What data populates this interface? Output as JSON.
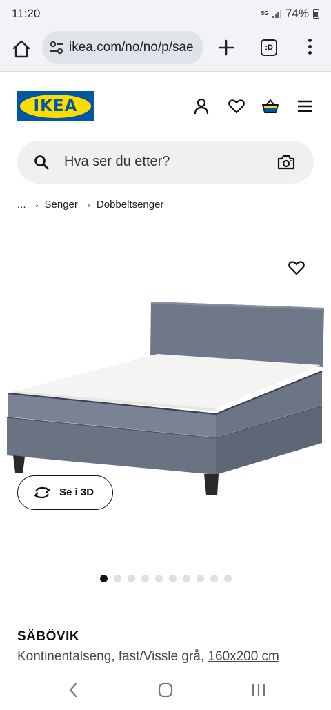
{
  "status_bar": {
    "time": "11:20",
    "network": "5G",
    "battery": "74%"
  },
  "browser": {
    "url": "ikea.com/no/no/p/sae",
    "tabs_label": ":D"
  },
  "header": {
    "logo_text": "IKEA"
  },
  "search": {
    "placeholder": "Hva ser du etter?"
  },
  "breadcrumb": {
    "ellipsis": "...",
    "items": [
      "Senger",
      "Dobbeltsenger"
    ]
  },
  "product": {
    "view_3d_label": "Se i 3D",
    "name": "SÄBÖVIK",
    "description": "Kontinentalseng, fast/Vissle grå,",
    "size": "160x200 cm",
    "image_count": 10,
    "active_image": 1
  },
  "colors": {
    "ikea_blue": "#0058a3",
    "ikea_yellow": "#ffdb00",
    "fabric_grey": "#6b7585"
  }
}
